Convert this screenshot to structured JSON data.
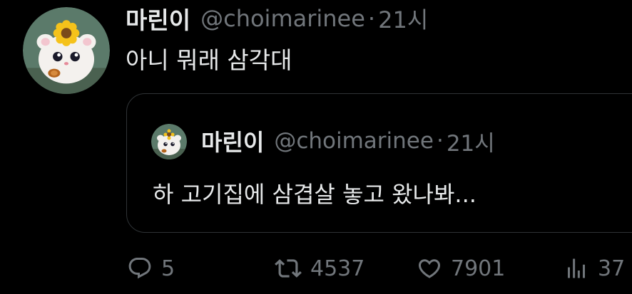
{
  "tweet": {
    "author": {
      "display_name": "마린이",
      "handle": "@choimarinee",
      "avatar_icon": "hamster-avatar-icon"
    },
    "separator": "·",
    "time": "21시",
    "text": "아니 뭐래 삼각대"
  },
  "quoted_tweet": {
    "author": {
      "display_name": "마린이",
      "handle": "@choimarinee",
      "avatar_icon": "hamster-avatar-icon"
    },
    "separator": "·",
    "time": "21시",
    "text": "하 고기집에 삼겹살 놓고 왔나봐..."
  },
  "actions": {
    "reply": {
      "icon": "reply-icon",
      "count": "5"
    },
    "retweet": {
      "icon": "retweet-icon",
      "count": "4537"
    },
    "like": {
      "icon": "heart-icon",
      "count": "7901"
    },
    "views": {
      "icon": "views-icon",
      "count": "37"
    }
  },
  "colors": {
    "background": "#000000",
    "primary_text": "#e7e9ea",
    "secondary_text": "#71767b",
    "card_border": "#2f3336"
  }
}
